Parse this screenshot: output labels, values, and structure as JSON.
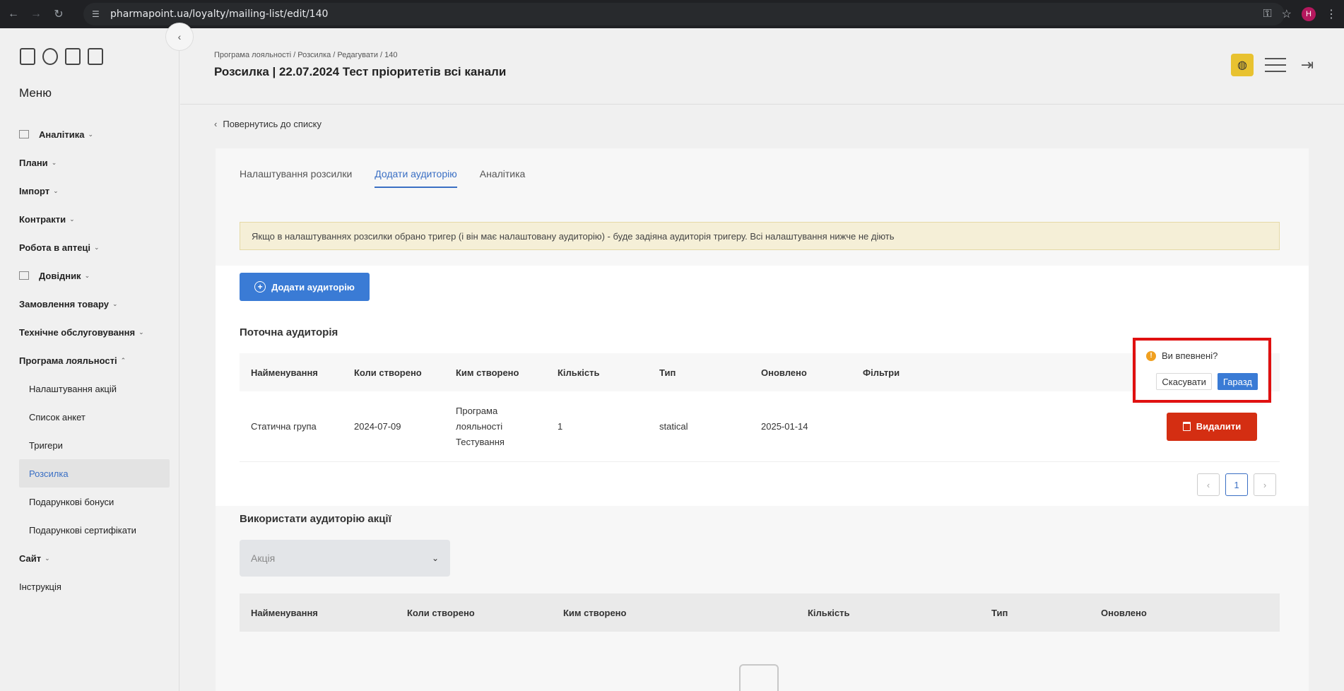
{
  "browser": {
    "url": "pharmapoint.ua/loyalty/mailing-list/edit/140",
    "avatar_letter": "H"
  },
  "sidebar": {
    "menu_title": "Меню",
    "items": [
      {
        "label": "Аналітика",
        "type": "group",
        "icon": "table-icon"
      },
      {
        "label": "Плани",
        "type": "group"
      },
      {
        "label": "Імпорт",
        "type": "group"
      },
      {
        "label": "Контракти",
        "type": "group"
      },
      {
        "label": "Робота в аптеці",
        "type": "group"
      },
      {
        "label": "Довідник",
        "type": "group",
        "icon": "list-icon"
      },
      {
        "label": "Замовлення товару",
        "type": "group"
      },
      {
        "label": "Технічне обслуговування",
        "type": "group"
      },
      {
        "label": "Програма лояльності",
        "type": "group-open"
      },
      {
        "label": "Налаштування акцій",
        "type": "sub"
      },
      {
        "label": "Список анкет",
        "type": "sub"
      },
      {
        "label": "Тригери",
        "type": "sub"
      },
      {
        "label": "Розсилка",
        "type": "sub-active"
      },
      {
        "label": "Подарункові бонуси",
        "type": "sub"
      },
      {
        "label": "Подарункові сертифікати",
        "type": "sub"
      },
      {
        "label": "Сайт",
        "type": "group"
      },
      {
        "label": "Інструкція",
        "type": "link"
      }
    ]
  },
  "header": {
    "breadcrumb": "Програма лояльності / Розсилка / Редагувати / 140",
    "title": "Розсилка | 22.07.2024 Тест пріоритетів всі канали"
  },
  "back_link": "Повернутись до списку",
  "tabs": [
    {
      "label": "Налаштування розсилки",
      "active": false
    },
    {
      "label": "Додати аудиторію",
      "active": true
    },
    {
      "label": "Аналітика",
      "active": false
    }
  ],
  "notice": "Якщо в налаштуваннях розсилки обрано тригер (і він має налаштовану аудиторію) - буде задіяна аудиторія тригеру. Всі налаштування нижче не діють",
  "add_audience_label": "Додати аудиторію",
  "current_audience": {
    "title": "Поточна аудиторія",
    "columns": [
      "Найменування",
      "Коли створено",
      "Ким створено",
      "Кількість",
      "Тип",
      "Оновлено",
      "Фільтри"
    ],
    "rows": [
      {
        "name": "Статична група",
        "created": "2024-07-09",
        "created_by": "Програма лояльності Тестування",
        "count": "1",
        "type": "statical",
        "updated": "2025-01-14",
        "filters": "",
        "delete_label": "Видалити"
      }
    ],
    "page": "1"
  },
  "popconfirm": {
    "message": "Ви впевнені?",
    "cancel": "Скасувати",
    "ok": "Гаразд"
  },
  "promo_audience": {
    "title": "Використати аудиторію акції",
    "select_placeholder": "Акція",
    "columns": [
      "Найменування",
      "Коли створено",
      "Ким створено",
      "Кількість",
      "Тип",
      "Оновлено"
    ]
  },
  "colors": {
    "primary": "#3a7bd5",
    "danger": "#d42e12",
    "warning": "#f0a020",
    "highlight": "#e01010"
  }
}
